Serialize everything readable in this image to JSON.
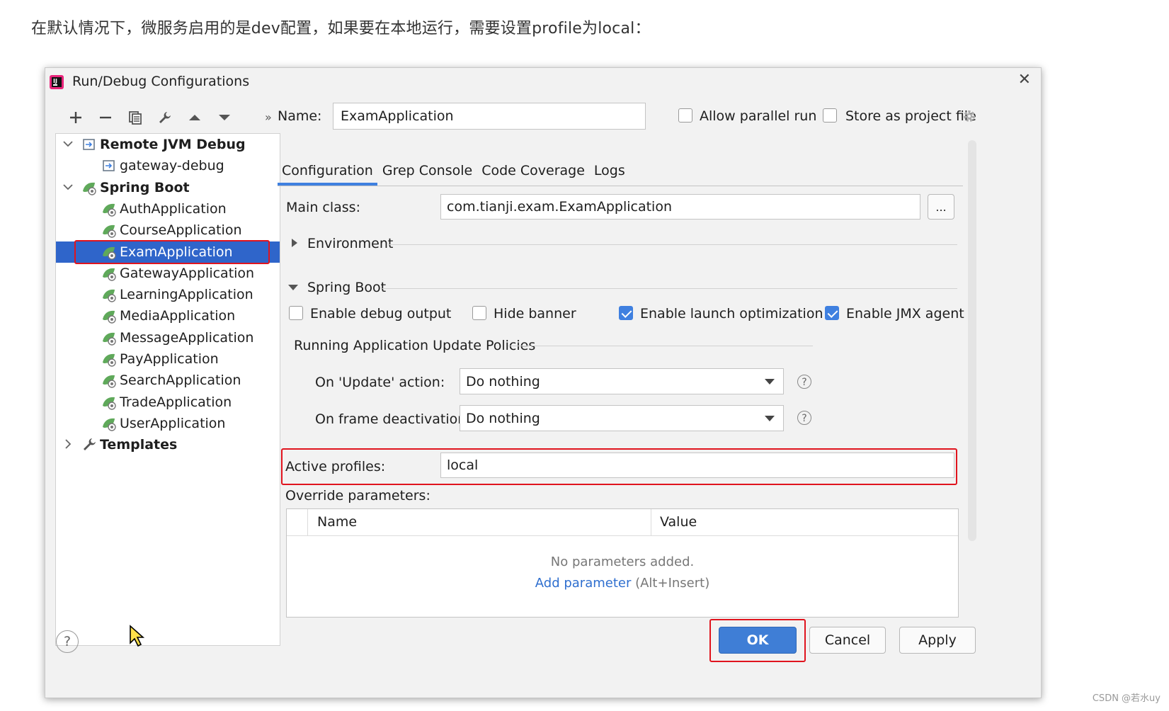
{
  "caption": "在默认情况下，微服务启用的是dev配置，如果要在本地运行，需要设置profile为local：",
  "watermark": "CSDN @若水uy",
  "dialog": {
    "title": "Run/Debug Configurations",
    "close": "✕"
  },
  "toolbar": {
    "more": "»",
    "icons": [
      "plus-icon",
      "minus-icon",
      "copy-icon",
      "wrench-icon",
      "arrow-up-icon",
      "arrow-down-icon"
    ]
  },
  "tree": {
    "group1": {
      "label": "Remote JVM Debug",
      "items": [
        "gateway-debug"
      ]
    },
    "group2": {
      "label": "Spring Boot",
      "items": [
        "AuthApplication",
        "CourseApplication",
        "ExamApplication",
        "GatewayApplication",
        "LearningApplication",
        "MediaApplication",
        "MessageApplication",
        "PayApplication",
        "SearchApplication",
        "TradeApplication",
        "UserApplication"
      ]
    },
    "group3": {
      "label": "Templates"
    },
    "selected": "ExamApplication"
  },
  "form": {
    "name_label": "Name:",
    "name_value": "ExamApplication",
    "allow_parallel": "Allow parallel run",
    "store_project": "Store as project file",
    "tabs": [
      "Configuration",
      "Grep Console",
      "Code Coverage",
      "Logs"
    ],
    "main_class_label": "Main class:",
    "main_class_value": "com.tianji.exam.ExamApplication",
    "browse": "...",
    "environment": "Environment",
    "spring_boot": "Spring Boot",
    "enable_debug": "Enable debug output",
    "hide_banner": "Hide banner",
    "launch_opt": "Enable launch optimization",
    "jmx": "Enable JMX agent",
    "policies": "Running Application Update Policies",
    "on_update_label": "On 'Update' action:",
    "on_update_value": "Do nothing",
    "on_frame_label": "On frame deactivation:",
    "on_frame_value": "Do nothing",
    "help": "?",
    "active_profiles_label": "Active profiles:",
    "active_profiles_value": "local",
    "override_label": "Override parameters:",
    "col_name": "Name",
    "col_value": "Value",
    "empty_text": "No parameters added.",
    "add_param": "Add parameter",
    "add_shortcut": " (Alt+Insert)"
  },
  "buttons": {
    "help": "?",
    "ok": "OK",
    "cancel": "Cancel",
    "apply": "Apply"
  },
  "colors": {
    "accent": "#3f80e0",
    "selection": "#2f65ca",
    "highlight": "#e0141e"
  }
}
